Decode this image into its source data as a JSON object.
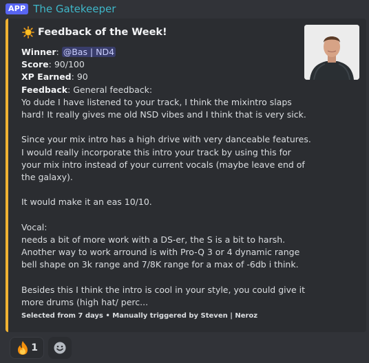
{
  "header": {
    "app_badge": "APP",
    "bot_name": "The Gatekeeper"
  },
  "embed": {
    "accent_color": "#f0b232",
    "title": "Feedback of the Week!",
    "title_icon": "sun-icon",
    "fields": {
      "winner_label": "Winner",
      "winner_value": "@Bas | ND4",
      "score_label": "Score",
      "score_value": "90/100",
      "xp_label": "XP Earned",
      "xp_value": "90",
      "feedback_label": "Feedback",
      "feedback_value": "General feedback:"
    },
    "lines": [
      "Yo dude I have listened to your track, I think the mixintro slaps",
      "hard! It really gives me old NSD vibes and I think that is very sick.",
      "",
      "Since your mix intro has a high drive with very danceable features.",
      "I would really incorporate this intro your track by using this for",
      "your mix intro instead of your current vocals (maybe leave end of",
      "the galaxy).",
      "",
      "It would make it an eas 10/10.",
      "",
      "Vocal:",
      "needs a bit of more work with a DS-er, the S is a bit to harsh.",
      "Another way to work arround is with Pro-Q 3 or 4 dynamic range",
      "bell shape on 3k range and 7/8K range for a max of -6db i think.",
      "",
      "Besides this I think the intro is cool in your style, you could give it",
      "more drums (high hat/ perc..."
    ],
    "footer": "Selected from 7 days • Manually triggered by Steven | Neroz"
  },
  "reactions": [
    {
      "icon": "fire-icon",
      "count": "1"
    },
    {
      "icon": "add-reaction-icon"
    }
  ]
}
